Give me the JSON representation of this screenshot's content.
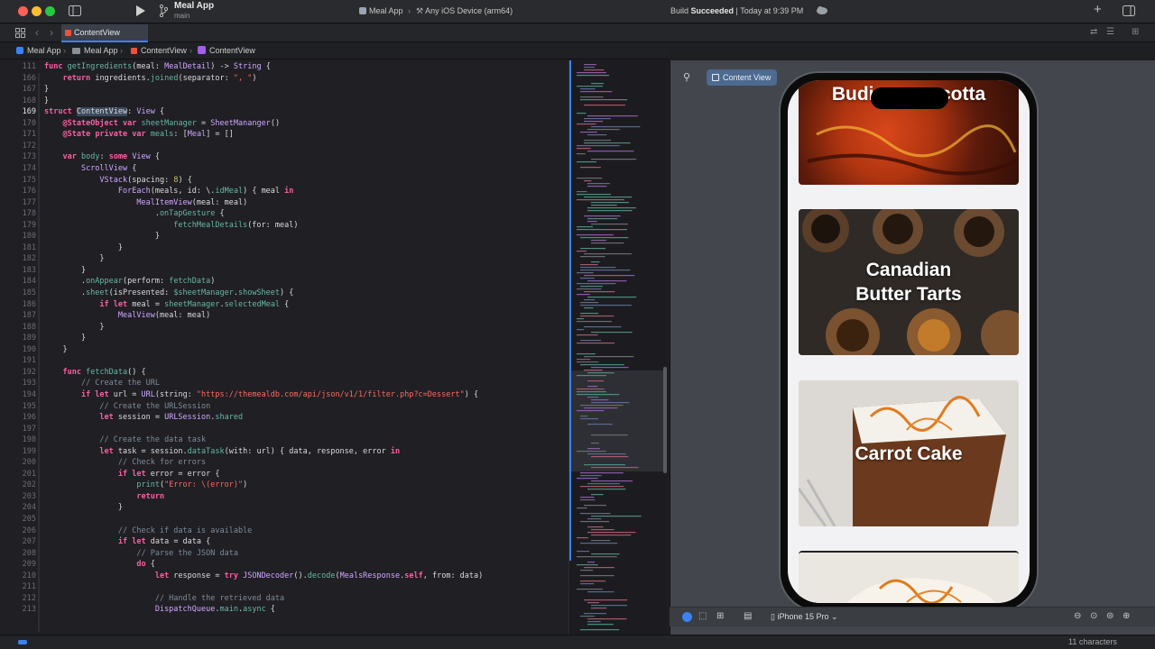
{
  "titlebar": {
    "app_name": "Meal App",
    "branch": "main",
    "scheme": "Meal App",
    "destination": "Any iOS Device (arm64)",
    "status_prefix": "Build ",
    "status_bold": "Succeeded",
    "status_time": " | Today at 9:39 PM"
  },
  "tabs": [
    {
      "label": "ContentView"
    }
  ],
  "breadcrumb": {
    "items": [
      "Meal App",
      "Meal App",
      "ContentView",
      "ContentView"
    ]
  },
  "editor": {
    "lines": [
      {
        "n": "111",
        "html": "<span class=\"kw\">func</span> <span class=\"fn\">getIngredients</span>(meal: <span class=\"ty\">MealDetail</span>) -> <span class=\"ty\">String</span> {"
      },
      {
        "n": "166",
        "html": "    <span class=\"kw\">return</span> ingredients.<span class=\"fn\">joined</span>(separator: <span class=\"str\">\", \"</span>)"
      },
      {
        "n": "167",
        "html": "}"
      },
      {
        "n": "168",
        "html": "}"
      },
      {
        "n": "169",
        "html": "<span class=\"kw\">struct</span> <span class=\"hl\">ContentView</span>: <span class=\"ty\">View</span> {"
      },
      {
        "n": "170",
        "html": "    <span class=\"kw\">@StateObject</span> <span class=\"kw\">var</span> <span class=\"fn\">sheetManager</span> = <span class=\"ty\">SheetMananger</span>()"
      },
      {
        "n": "171",
        "html": "    <span class=\"kw\">@State</span> <span class=\"kw\">private var</span> <span class=\"fn\">meals</span>: [<span class=\"ty\">Meal</span>] = []"
      },
      {
        "n": "172",
        "html": ""
      },
      {
        "n": "173",
        "html": "    <span class=\"kw\">var</span> <span class=\"fn\">body</span>: <span class=\"kw\">some</span> <span class=\"ty\">View</span> {"
      },
      {
        "n": "174",
        "html": "        <span class=\"ty\">ScrollView</span> {"
      },
      {
        "n": "175",
        "html": "            <span class=\"ty\">VStack</span>(spacing: <span class=\"num\">8</span>) {"
      },
      {
        "n": "176",
        "html": "                <span class=\"ty\">ForEach</span>(meals, id: \\.<span class=\"fn\">idMeal</span>) { meal <span class=\"kw\">in</span>"
      },
      {
        "n": "177",
        "html": "                    <span class=\"ty\">MealItemView</span>(meal: meal)"
      },
      {
        "n": "178",
        "html": "                        .<span class=\"fn\">onTapGesture</span> {"
      },
      {
        "n": "179",
        "html": "                            <span class=\"fn\">fetchMealDetails</span>(for: meal)"
      },
      {
        "n": "180",
        "html": "                        }"
      },
      {
        "n": "181",
        "html": "                }"
      },
      {
        "n": "182",
        "html": "            }"
      },
      {
        "n": "183",
        "html": "        }"
      },
      {
        "n": "184",
        "html": "        .<span class=\"fn\">onAppear</span>(perform: <span class=\"fn\">fetchData</span>)"
      },
      {
        "n": "185",
        "html": "        .<span class=\"fn\">sheet</span>(isPresented: <span class=\"fn\">$sheetManager</span>.<span class=\"fn\">showSheet</span>) {"
      },
      {
        "n": "186",
        "html": "            <span class=\"kw\">if let</span> meal = <span class=\"fn\">sheetManager</span>.<span class=\"fn\">selectedMeal</span> {"
      },
      {
        "n": "187",
        "html": "                <span class=\"ty\">MealView</span>(meal: meal)"
      },
      {
        "n": "188",
        "html": "            }"
      },
      {
        "n": "189",
        "html": "        }"
      },
      {
        "n": "190",
        "html": "    }"
      },
      {
        "n": "191",
        "html": ""
      },
      {
        "n": "192",
        "html": "    <span class=\"kw\">func</span> <span class=\"fn\">fetchData</span>() {"
      },
      {
        "n": "193",
        "html": "        <span class=\"cm\">// Create the URL</span>"
      },
      {
        "n": "194",
        "html": "        <span class=\"kw\">if let</span> url = <span class=\"ty\">URL</span>(string: <span class=\"str\">\"https://themealdb.com/api/json/v1/1/filter.php?c=Dessert\"</span>) {"
      },
      {
        "n": "195",
        "html": "            <span class=\"cm\">// Create the URLSession</span>"
      },
      {
        "n": "196",
        "html": "            <span class=\"kw\">let</span> session = <span class=\"ty\">URLSession</span>.<span class=\"fn\">shared</span>"
      },
      {
        "n": "197",
        "html": ""
      },
      {
        "n": "198",
        "html": "            <span class=\"cm\">// Create the data task</span>"
      },
      {
        "n": "199",
        "html": "            <span class=\"kw\">let</span> task = session.<span class=\"fn\">dataTask</span>(with: url) { data, response, error <span class=\"kw\">in</span>"
      },
      {
        "n": "200",
        "html": "                <span class=\"cm\">// Check for errors</span>"
      },
      {
        "n": "201",
        "html": "                <span class=\"kw\">if let</span> error = error {"
      },
      {
        "n": "202",
        "html": "                    <span class=\"fn\">print</span>(<span class=\"str\">\"Error: \\(error)\"</span>)"
      },
      {
        "n": "203",
        "html": "                    <span class=\"kw\">return</span>"
      },
      {
        "n": "204",
        "html": "                }"
      },
      {
        "n": "205",
        "html": ""
      },
      {
        "n": "206",
        "html": "                <span class=\"cm\">// Check if data is available</span>"
      },
      {
        "n": "207",
        "html": "                <span class=\"kw\">if let</span> data = data {"
      },
      {
        "n": "208",
        "html": "                    <span class=\"cm\">// Parse the JSON data</span>"
      },
      {
        "n": "209",
        "html": "                    <span class=\"kw\">do</span> {"
      },
      {
        "n": "210",
        "html": "                        <span class=\"kw\">let</span> response = <span class=\"kw\">try</span> <span class=\"ty\">JSONDecoder</span>().<span class=\"fn\">decode</span>(<span class=\"ty\">MealsResponse</span>.<span class=\"kw\">self</span>, from: data)"
      },
      {
        "n": "211",
        "html": ""
      },
      {
        "n": "212",
        "html": "                        <span class=\"cm\">// Handle the retrieved data</span>"
      },
      {
        "n": "213",
        "html": "                        <span class=\"ty\">DispatchQueue</span>.<span class=\"fn\">main</span>.<span class=\"fn\">async</span> {"
      }
    ]
  },
  "canvas": {
    "pill_label": "Content View",
    "device_label": "iPhone 15 Pro",
    "meals": [
      {
        "title": "Budino Di Ricotta",
        "visible_title": "Budi       cotta"
      },
      {
        "title": "Canadian Butter Tarts",
        "visible_title": "Canadian\nButter Tarts"
      },
      {
        "title": "Carrot Cake",
        "visible_title": "Carrot Cake"
      }
    ]
  },
  "statusbar": {
    "count": "11 characters"
  },
  "colors": {
    "accent": "#3b82f6",
    "editor_bg": "#1f1f24",
    "canvas_bg": "#43464c"
  },
  "icons": [
    "close-light",
    "minimize-light",
    "zoom-light",
    "sidebar-icon",
    "play-icon",
    "branch-icon",
    "swift-icon",
    "hammer-icon",
    "cloud-icon",
    "plus-icon",
    "inspector-icon",
    "grid-icon",
    "back-icon",
    "forward-icon",
    "pin-icon",
    "preview-icon",
    "zoom-out-icon",
    "zoom-in-icon"
  ]
}
